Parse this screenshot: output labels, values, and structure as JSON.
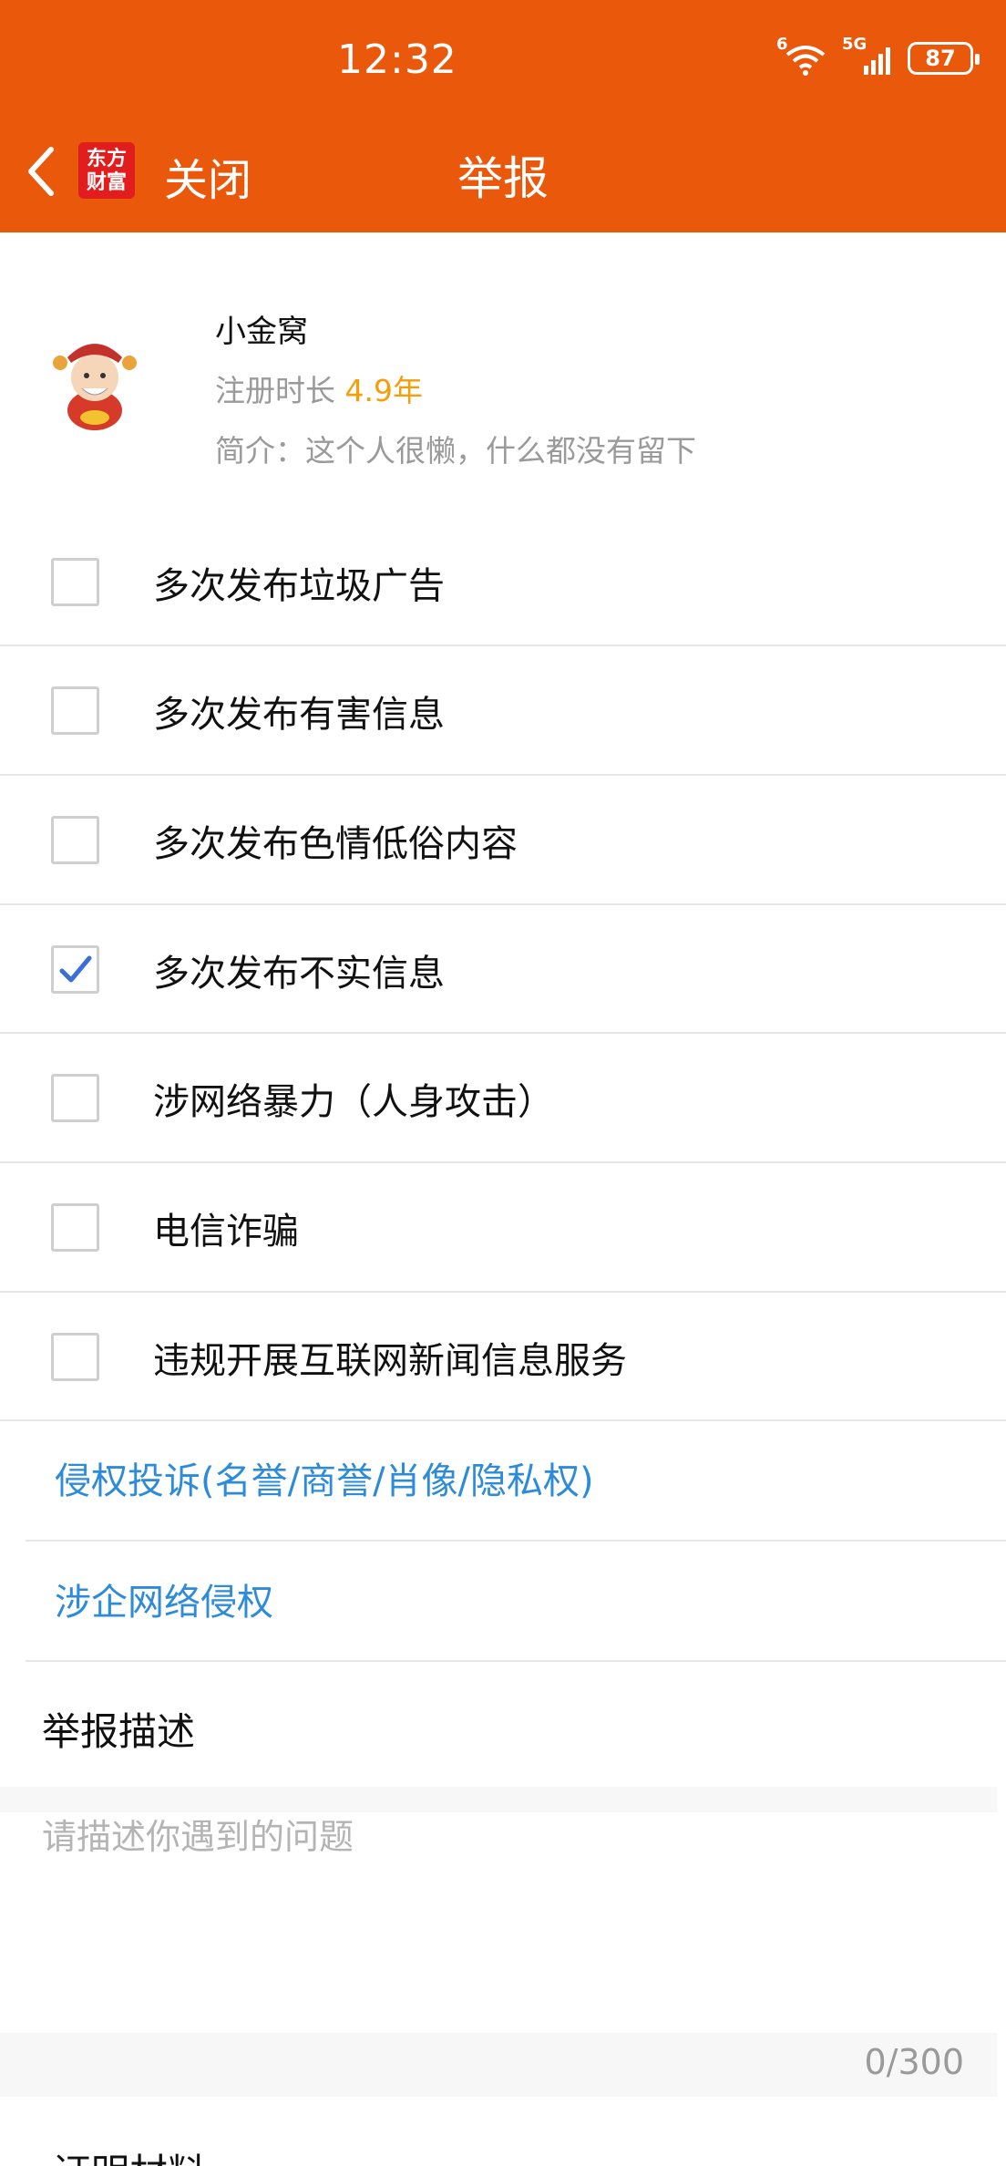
{
  "status_bar": {
    "time": "12:32",
    "wifi_label": "6",
    "network": "5G",
    "battery": "87"
  },
  "header": {
    "close_label": "关闭",
    "title": "举报",
    "logo_line1": "东方",
    "logo_line2": "财富"
  },
  "profile": {
    "name": "小金窝",
    "reg_label": "注册时长 ",
    "reg_value": "4.9年",
    "bio": "简介：这个人很懒，什么都没有留下"
  },
  "options": [
    {
      "label": "多次发布垃圾广告",
      "checked": false
    },
    {
      "label": "多次发布有害信息",
      "checked": false
    },
    {
      "label": "多次发布色情低俗内容",
      "checked": false
    },
    {
      "label": "多次发布不实信息",
      "checked": true
    },
    {
      "label": "涉网络暴力（人身攻击）",
      "checked": false
    },
    {
      "label": "电信诈骗",
      "checked": false
    },
    {
      "label": "违规开展互联网新闻信息服务",
      "checked": false
    }
  ],
  "links": [
    {
      "label": "侵权投诉(名誉/商誉/肖像/隐私权)"
    },
    {
      "label": "涉企网络侵权"
    }
  ],
  "description": {
    "title": "举报描述",
    "placeholder": "请描述你遇到的问题",
    "counter": "0/300"
  },
  "evidence": {
    "title": "证明材料"
  },
  "colors": {
    "header": "#EA580C",
    "accent_link": "#2E8BD8",
    "years": "#F59E0B",
    "check": "#3A6FD8"
  }
}
